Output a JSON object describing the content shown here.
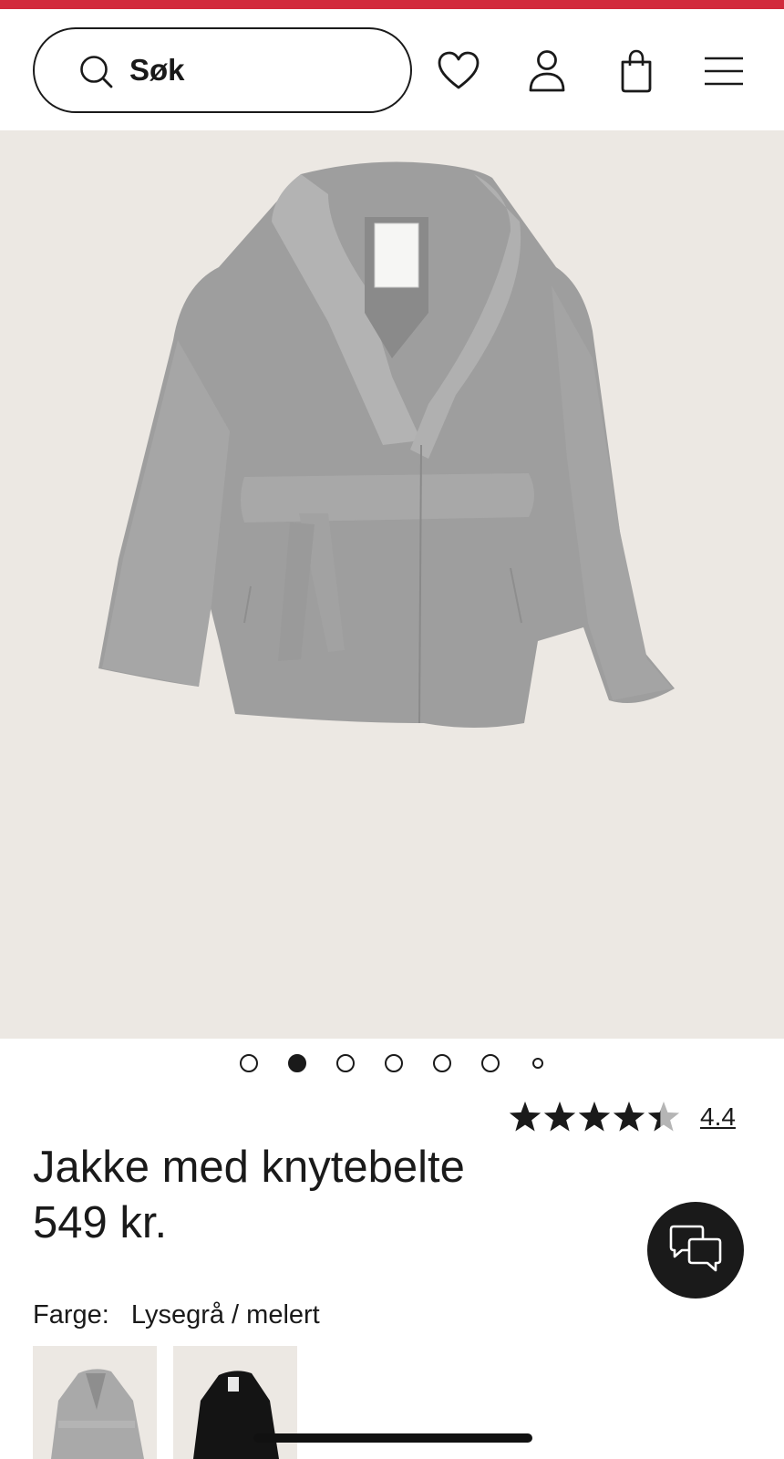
{
  "brand": {
    "accent_color": "#d22a3c"
  },
  "header": {
    "search_placeholder": "Søk",
    "icons": [
      "search-icon",
      "heart-icon",
      "user-icon",
      "bag-icon",
      "menu-icon"
    ]
  },
  "gallery": {
    "image": "coat-photo",
    "dot_count": 7,
    "active_index": 1
  },
  "product": {
    "title": "Jakke med knytebelte",
    "price": "549 kr.",
    "rating_value": "4.4",
    "rating_stars": 4.4,
    "rating_max": 5
  },
  "color_picker": {
    "label": "Farge:",
    "selected": "Lysegrå / melert",
    "swatches": [
      {
        "name": "Lysegrå / melert",
        "color": "#a9a9a9"
      },
      {
        "name": "black",
        "color": "#141414"
      }
    ]
  },
  "chat": {
    "icon": "chat-bubbles-icon"
  }
}
